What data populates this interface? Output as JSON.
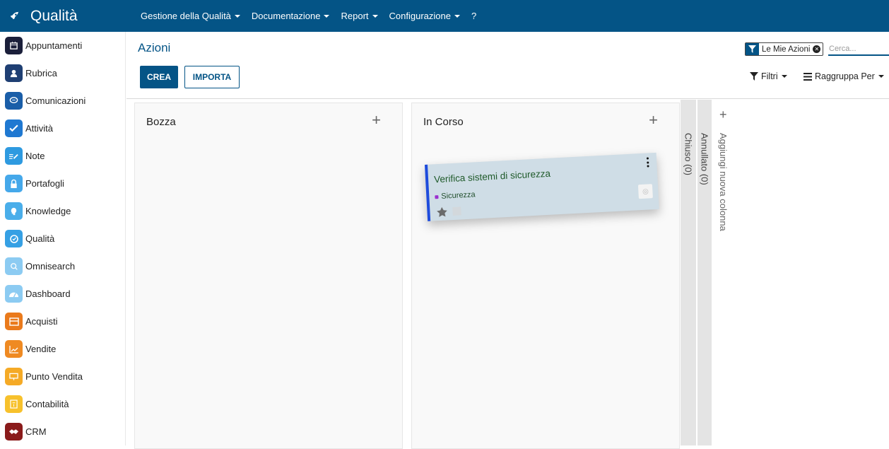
{
  "app": {
    "title": "Qualità",
    "brand_icon": "rocket-icon",
    "colors": {
      "primary": "#045486",
      "card_bg": "#cfdde6",
      "card_border": "#1e4bdc",
      "tag_dot": "#9b30cf"
    }
  },
  "topmenu": [
    {
      "label": "Gestione della Qualità",
      "dropdown": true
    },
    {
      "label": "Documentazione",
      "dropdown": true
    },
    {
      "label": "Report",
      "dropdown": true
    },
    {
      "label": "Configurazione",
      "dropdown": true
    },
    {
      "label": "?",
      "dropdown": false
    }
  ],
  "sidebar": {
    "items": [
      {
        "label": "Appuntamenti",
        "icon": "calendar-icon",
        "color": "#1b1f3a"
      },
      {
        "label": "Rubrica",
        "icon": "contacts-icon",
        "color": "#1f3f73"
      },
      {
        "label": "Comunicazioni",
        "icon": "chat-icon",
        "color": "#1a5ea8"
      },
      {
        "label": "Attività",
        "icon": "check-icon",
        "color": "#1f78d1"
      },
      {
        "label": "Note",
        "icon": "note-icon",
        "color": "#2e9ae0"
      },
      {
        "label": "Portafogli",
        "icon": "lock-icon",
        "color": "#45a8ea"
      },
      {
        "label": "Knowledge",
        "icon": "brain-icon",
        "color": "#4aaeea"
      },
      {
        "label": "Qualità",
        "icon": "quality-icon",
        "color": "#36a0e4"
      },
      {
        "label": "Omnisearch",
        "icon": "search-icon",
        "color": "#8ccbf2"
      },
      {
        "label": "Dashboard",
        "icon": "dashboard-icon",
        "color": "#8ccbf2"
      },
      {
        "label": "Acquisti",
        "icon": "purchase-icon",
        "color": "#ea7a1c"
      },
      {
        "label": "Vendite",
        "icon": "sales-chart-icon",
        "color": "#ef8a22"
      },
      {
        "label": "Punto Vendita",
        "icon": "pos-icon",
        "color": "#f5aa26"
      },
      {
        "label": "Contabilità",
        "icon": "accounting-icon",
        "color": "#f7c12c"
      },
      {
        "label": "CRM",
        "icon": "handshake-icon",
        "color": "#8a1b1b"
      }
    ]
  },
  "control_panel": {
    "title": "Azioni",
    "create_label": "CREA",
    "import_label": "IMPORTA",
    "facet_value": "Le Mie Azioni",
    "search_placeholder": "Cerca...",
    "filters_label": "Filtri",
    "groupby_label": "Raggruppa Per"
  },
  "kanban": {
    "columns": [
      {
        "title": "Bozza",
        "folded": false
      },
      {
        "title": "In Corso",
        "folded": false
      }
    ],
    "folded_columns": [
      {
        "title": "Chiuso (0)"
      },
      {
        "title": "Annullato (0)"
      }
    ],
    "add_column_label": "Aggiungi nuova colonna",
    "card": {
      "title": "Verifica sistemi di sicurezza",
      "tag": "Sicurezza",
      "column": "In Corso",
      "state": "dragging"
    }
  }
}
